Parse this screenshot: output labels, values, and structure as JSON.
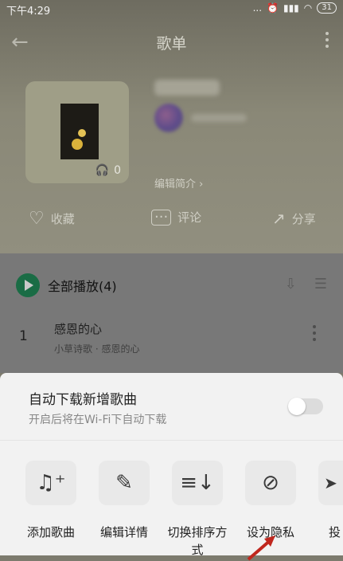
{
  "status_bar": {
    "time": "下午4:29",
    "dots": "...",
    "battery": "31"
  },
  "nav": {
    "title": "歌单"
  },
  "cover": {
    "listen_count": "0"
  },
  "intro_link": "编辑简介",
  "actions": {
    "favorite": "收藏",
    "comment": "评论",
    "share": "分享"
  },
  "list": {
    "play_all": "全部播放(4)",
    "songs": [
      {
        "index": "1",
        "title": "感恩的心",
        "subtitle": "小草诗歌 · 感恩的心"
      }
    ]
  },
  "sheet": {
    "auto_download_title": "自动下载新增歌曲",
    "auto_download_sub": "开启后将在Wi-Fi下自动下载",
    "auto_download_on": false,
    "tools": [
      {
        "label": "添加歌曲",
        "icon": "music-add-icon"
      },
      {
        "label": "编辑详情",
        "icon": "pencil-icon"
      },
      {
        "label": "切换排序方式",
        "icon": "sort-icon"
      },
      {
        "label": "设为隐私",
        "icon": "eye-off-icon"
      },
      {
        "label": "投",
        "icon": "send-icon"
      }
    ]
  },
  "colors": {
    "accent_green": "#1a6c45",
    "arrow_red": "#c0271e"
  }
}
